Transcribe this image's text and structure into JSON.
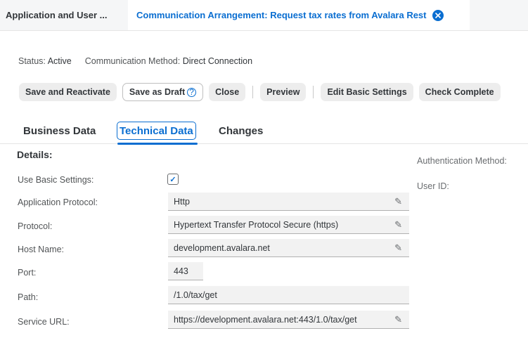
{
  "tabs": {
    "inactive_label": "Application and User ...",
    "active_label": "Communication Arrangement: Request tax rates from Avalara Rest",
    "close_icon": "×"
  },
  "status": {
    "status_label": "Status:",
    "status_value": "Active",
    "method_label": "Communication Method:",
    "method_value": "Direct Connection"
  },
  "toolbar": {
    "save_reactivate": "Save and Reactivate",
    "save_draft": "Save as Draft",
    "help_icon": "?",
    "close": "Close",
    "preview": "Preview",
    "edit_basic": "Edit Basic Settings",
    "check_complete": "Check Complete"
  },
  "section_tabs": {
    "business": "Business Data",
    "technical": "Technical Data",
    "changes": "Changes"
  },
  "details": {
    "title": "Details:",
    "use_basic_label": "Use Basic Settings:",
    "use_basic_checked": "✓",
    "app_protocol_label": "Application Protocol:",
    "app_protocol_value": "Http",
    "protocol_label": "Protocol:",
    "protocol_value": "Hypertext Transfer Protocol Secure (https)",
    "host_label": "Host Name:",
    "host_value": "development.avalara.net",
    "port_label": "Port:",
    "port_value": "443",
    "path_label": "Path:",
    "path_value": "/1.0/tax/get",
    "service_url_label": "Service URL:",
    "service_url_value": "https://development.avalara.net:443/1.0/tax/get",
    "pencil_icon": "✎"
  },
  "right": {
    "auth_label": "Authentication Method:",
    "user_id_label": "User ID:"
  }
}
